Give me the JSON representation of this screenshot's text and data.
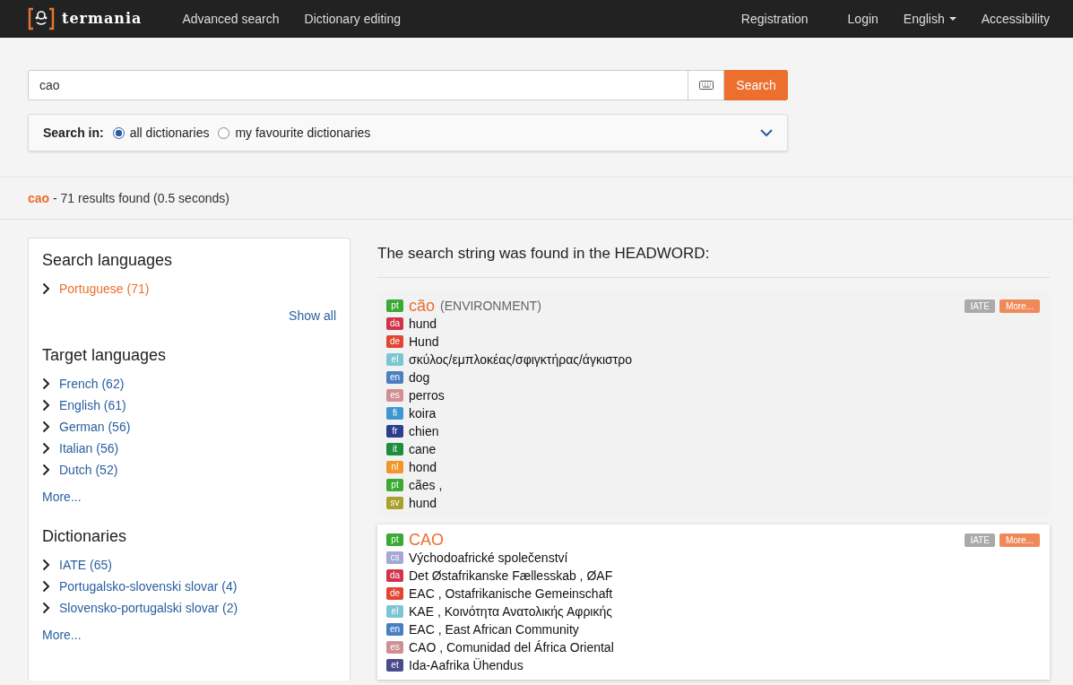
{
  "navbar": {
    "logo": "termania",
    "links": [
      "Advanced search",
      "Dictionary editing"
    ],
    "right_links": [
      {
        "label": "Registration",
        "dropdown": false
      },
      {
        "label": "Login",
        "dropdown": false
      },
      {
        "label": "English",
        "dropdown": true
      },
      {
        "label": "Accessibility",
        "dropdown": false
      }
    ]
  },
  "search": {
    "value": "cao",
    "button": "Search",
    "scope_label": "Search in:",
    "options": [
      {
        "label": "all dictionaries",
        "selected": true
      },
      {
        "label": "my favourite dictionaries",
        "selected": false
      }
    ]
  },
  "summary": {
    "query": "cao",
    "text": " - 71 results found (0.5 seconds)"
  },
  "sidebar": {
    "sections": [
      {
        "title": "Search languages",
        "items": [
          {
            "label": "Portuguese (71)",
            "selected": true
          }
        ],
        "more": "Show all",
        "kind": "show_all"
      },
      {
        "title": "Target languages",
        "items": [
          {
            "label": "French (62)",
            "selected": false
          },
          {
            "label": "English (61)",
            "selected": false
          },
          {
            "label": "German (56)",
            "selected": false
          },
          {
            "label": "Italian (56)",
            "selected": false
          },
          {
            "label": "Dutch (52)",
            "selected": false
          }
        ],
        "more": "More...",
        "kind": "more"
      },
      {
        "title": "Dictionaries",
        "items": [
          {
            "label": "IATE (65)",
            "selected": false
          },
          {
            "label": "Portugalsko-slovenski slovar (4)",
            "selected": false
          },
          {
            "label": "Slovensko-portugalski slovar (2)",
            "selected": false
          }
        ],
        "more": "More...",
        "kind": "more"
      }
    ]
  },
  "results": {
    "heading": "The search string was found in the HEADWORD:",
    "entries": [
      {
        "highlighted": false,
        "lang": "pt",
        "color": "#3aaa35",
        "headword": "cão",
        "domain": "(ENVIRONMENT)",
        "source": "IATE",
        "more": "More...",
        "translations": [
          {
            "lang": "da",
            "color": "#d2334a",
            "text": "hund"
          },
          {
            "lang": "de",
            "color": "#e24532",
            "text": "Hund"
          },
          {
            "lang": "el",
            "color": "#7cc6d4",
            "text": "σκύλος/εμπλοκέας/σφιγκτήρας/άγκιστρο"
          },
          {
            "lang": "en",
            "color": "#4a7fc1",
            "text": "dog"
          },
          {
            "lang": "es",
            "color": "#d09093",
            "text": "perros"
          },
          {
            "lang": "fi",
            "color": "#3d98cf",
            "text": "koira"
          },
          {
            "lang": "fr",
            "color": "#2b3f8e",
            "text": "chien"
          },
          {
            "lang": "it",
            "color": "#1e8e3e",
            "text": "cane"
          },
          {
            "lang": "nl",
            "color": "#f0962a",
            "text": "hond"
          },
          {
            "lang": "pt",
            "color": "#3aaa35",
            "text": "cães ,"
          },
          {
            "lang": "sv",
            "color": "#a8a12e",
            "text": "hund"
          }
        ]
      },
      {
        "highlighted": true,
        "lang": "pt",
        "color": "#3aaa35",
        "headword": "CAO",
        "source": "IATE",
        "more": "More...",
        "translations": [
          {
            "lang": "cs",
            "color": "#a3a8d6",
            "text": "Východoafrické společenství"
          },
          {
            "lang": "da",
            "color": "#d2334a",
            "text": "Det Østafrikanske Fællesskab , ØAF"
          },
          {
            "lang": "de",
            "color": "#e24532",
            "text": "EAC , Ostafrikanische Gemeinschaft"
          },
          {
            "lang": "el",
            "color": "#7cc6d4",
            "text": "KAE , Κοινότητα Ανατολικής Αφρικής"
          },
          {
            "lang": "en",
            "color": "#4a7fc1",
            "text": "EAC , East African Community"
          },
          {
            "lang": "es",
            "color": "#d09093",
            "text": "CAO , Comunidad del África Oriental"
          },
          {
            "lang": "et",
            "color": "#4a4a8e",
            "text": "Ida-Aafrika Ühendus"
          }
        ]
      }
    ]
  }
}
